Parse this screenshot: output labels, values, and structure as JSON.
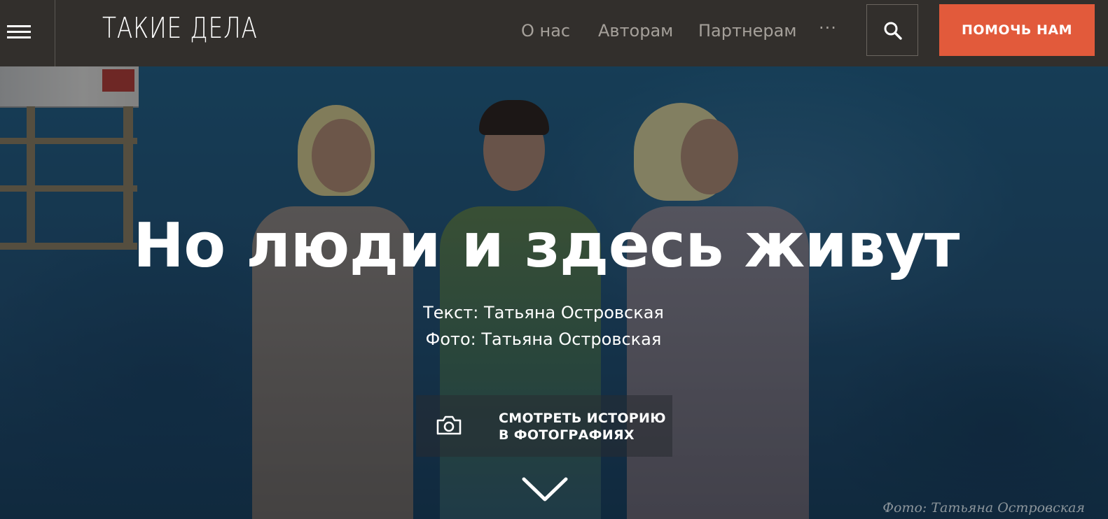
{
  "header": {
    "logo_text": "ТАКИЕ ДЕЛА",
    "nav": [
      {
        "label": "О нас"
      },
      {
        "label": "Авторам"
      },
      {
        "label": "Партнерам"
      }
    ],
    "more_label": "···",
    "donate_label": "ПОМОЧЬ НАМ",
    "accent_color": "#e25a3b"
  },
  "hero": {
    "title": "Но люди и здесь живут",
    "text_credit": "Текст: Татьяна Островская",
    "photo_credit": "Фото: Татьяна Островская",
    "photo_button": {
      "line1": "СМОТРЕТЬ ИСТОРИЮ",
      "line2": "В ФОТОГРАФИЯХ"
    },
    "image_caption": "Фото: Татьяна Островская"
  },
  "icons": [
    "menu-icon",
    "search-icon",
    "camera-icon",
    "chevron-down-icon"
  ]
}
